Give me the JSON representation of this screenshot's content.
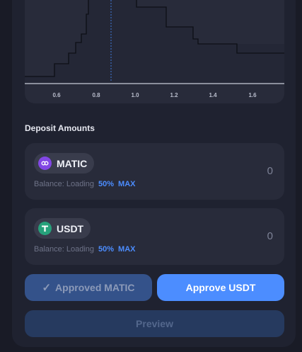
{
  "chart": {
    "x_ticks": [
      "0.6",
      "0.8",
      "1.0",
      "1.2",
      "1.4",
      "1.6"
    ]
  },
  "deposit": {
    "title": "Deposit Amounts",
    "tokens": [
      {
        "symbol": "MATIC",
        "icon": "matic-icon",
        "icon_color": "#8247e5",
        "balance_label": "Balance: Loading",
        "pct_50": "50%",
        "max": "MAX",
        "amount": "0"
      },
      {
        "symbol": "USDT",
        "icon": "usdt-icon",
        "icon_color": "#26a17b",
        "balance_label": "Balance: Loading",
        "pct_50": "50%",
        "max": "MAX",
        "amount": "0"
      }
    ]
  },
  "buttons": {
    "approved_check": "✓",
    "approved_label": "Approved MATIC",
    "approve_label": "Approve USDT",
    "preview_label": "Preview"
  },
  "colors": {
    "accent": "#4c8dff",
    "panel": "#1f2230",
    "card": "#282b3a"
  }
}
